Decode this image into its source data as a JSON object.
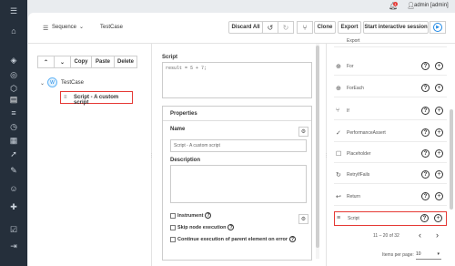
{
  "topbar": {
    "notification_count": "1",
    "user_label": "admin [admin]"
  },
  "sidebar": {
    "icons": [
      "menu-icon",
      "home-icon",
      "cube-icon",
      "target-icon",
      "box-icon",
      "document-icon",
      "list-icon",
      "clock-icon",
      "calendar-icon",
      "rocket-icon",
      "wrench-icon",
      "user-icon",
      "puzzle-icon",
      "checkbox-icon",
      "logout-icon"
    ]
  },
  "toolbar": {
    "sequence_label": "Sequence",
    "testcase_label": "TestCase",
    "discard_all": "Discard All",
    "clone": "Clone",
    "export": "Export",
    "start_session": "Start interactive session"
  },
  "tree": {
    "buttons": [
      "Copy",
      "Paste",
      "Delete"
    ],
    "root_label": "TestCase",
    "root_icon_letter": "W",
    "child_label": "Script - A custom script"
  },
  "script": {
    "title": "Script",
    "code": "result = 5 + 7;"
  },
  "properties": {
    "title": "Properties",
    "name_label": "Name",
    "name_value": "Script - A custom script",
    "description_label": "Description",
    "checkboxes": [
      {
        "label": "Instrument"
      },
      {
        "label": "Skip node execution"
      },
      {
        "label": "Continue execution of parent element on error"
      }
    ]
  },
  "palette": {
    "items": [
      {
        "label": "Export",
        "icon": "export-icon"
      },
      {
        "label": "For",
        "icon": "globe-icon"
      },
      {
        "label": "ForEach",
        "icon": "globe-icon"
      },
      {
        "label": "If",
        "icon": "branch-icon"
      },
      {
        "label": "PerformanceAssert",
        "icon": "check-icon"
      },
      {
        "label": "Placeholder",
        "icon": "square-icon"
      },
      {
        "label": "RetryIfFails",
        "icon": "retry-icon"
      },
      {
        "label": "Return",
        "icon": "return-icon"
      },
      {
        "label": "Script",
        "icon": "script-icon"
      }
    ],
    "pager_text": "11 – 20 of 32",
    "items_per_page_label": "Items per page:",
    "items_per_page_value": "10"
  },
  "colors": {
    "sidebar_bg": "#252f3b",
    "highlight": "#e53935",
    "accent": "#1e88e5"
  }
}
